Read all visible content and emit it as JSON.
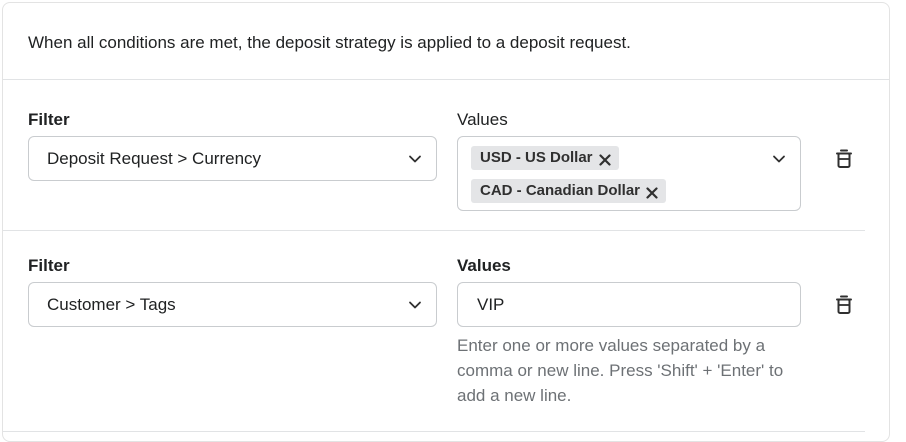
{
  "intro_text": "When all conditions are met, the deposit strategy is applied to a deposit request.",
  "conditions": [
    {
      "filter_label": "Filter",
      "filter_value": "Deposit Request > Currency",
      "values_label": "Values",
      "tags": [
        "USD - US Dollar",
        "CAD - Canadian Dollar"
      ]
    },
    {
      "filter_label": "Filter",
      "filter_value": "Customer > Tags",
      "values_label": "Values",
      "input_value": "VIP",
      "help_text": "Enter one or more values separated by a comma or new line. Press 'Shift' + 'Enter' to add a new line."
    }
  ],
  "icons": {
    "chevron": "chevron-down-icon",
    "remove_tag": "close-icon",
    "delete_condition": "trash-icon"
  }
}
